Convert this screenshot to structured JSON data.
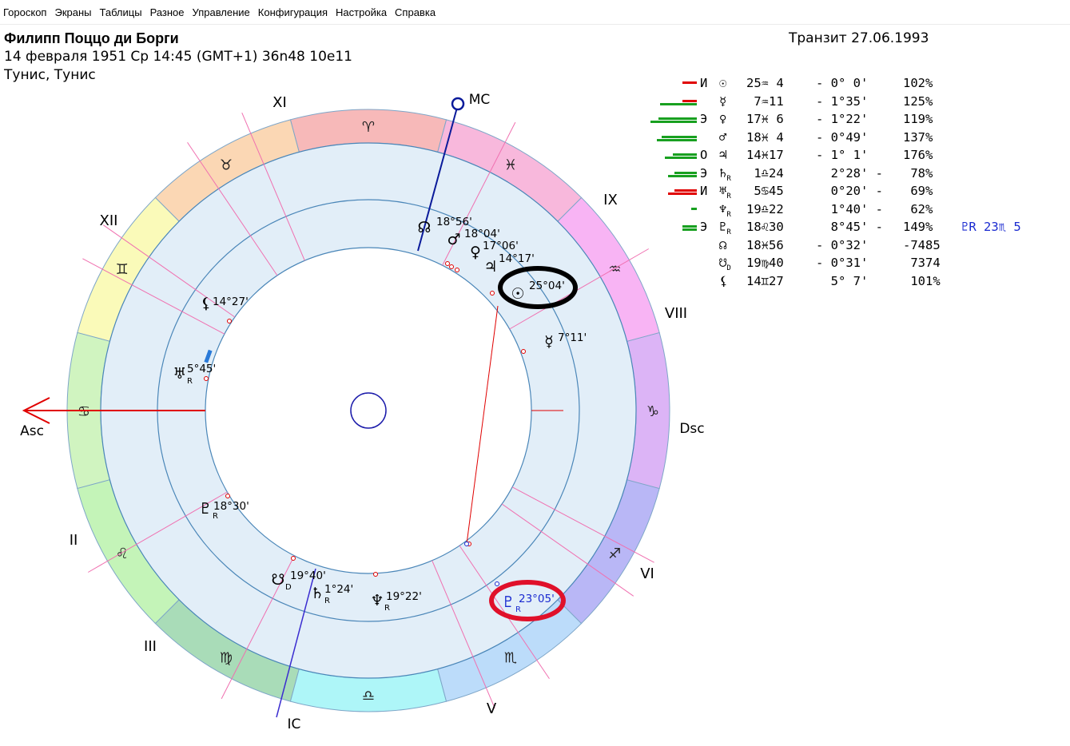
{
  "menu": [
    "Гороскоп",
    "Экраны",
    "Таблицы",
    "Разное",
    "Управление",
    "Конфигурация",
    "Настройка",
    "Справка"
  ],
  "header": {
    "name": "Филипп Поццо ди Борги",
    "date_line": "14 февраля 1951  Ср  14:45 (GMT+1) 36n48  10e11",
    "place": "Тунис, Тунис",
    "transit": "Транзит 27.06.1993"
  },
  "houses": {
    "labels": [
      "XI",
      "IX",
      "XII",
      "VIII",
      "II",
      "VI",
      "III",
      "V"
    ],
    "angles": {
      "mc": "MC",
      "asc": "Asc",
      "dsc": "Dsc",
      "ic": "IC"
    }
  },
  "zodiac_glyphs": [
    "♈",
    "♉",
    "♊",
    "♋",
    "♌",
    "♍",
    "♎",
    "♏",
    "♐",
    "♑",
    "♒",
    "♓"
  ],
  "inner_planets": [
    {
      "glyph": "☊",
      "deg": "18°56'"
    },
    {
      "glyph": "♂",
      "deg": "18°04'"
    },
    {
      "glyph": "♀",
      "deg": "17°06'"
    },
    {
      "glyph": "♃",
      "deg": "14°17'"
    },
    {
      "glyph": "☉",
      "deg": "25°04'"
    },
    {
      "glyph": "☿",
      "deg": "7°11'"
    },
    {
      "glyph": "⚸",
      "deg": "14°27'"
    },
    {
      "glyph": "♅",
      "sub": "R",
      "deg": "5°45'"
    },
    {
      "glyph": "♇",
      "sub": "R",
      "deg": "18°30'"
    },
    {
      "glyph": "☋",
      "sub": "D",
      "deg": "19°40'"
    },
    {
      "glyph": "♄",
      "sub": "R",
      "deg": "1°24'"
    },
    {
      "glyph": "♆",
      "sub": "R",
      "deg": "19°22'"
    },
    {
      "glyph": "♇",
      "sub": "R",
      "deg": "23°05'"
    }
  ],
  "aspect_table": [
    {
      "flag": "И",
      "glyph": "☉",
      "pos": "25♒ 4",
      "orb": "- 0° 0'",
      "pct": "102%",
      "bars": [
        {
          "c": "#e00000",
          "w": 18
        }
      ]
    },
    {
      "flag": "",
      "glyph": "☿",
      "pos": " 7♒11",
      "orb": "- 1°35'",
      "pct": "125%",
      "bars": [
        {
          "c": "#e00000",
          "w": 18
        },
        {
          "c": "#18a020",
          "w": 46
        }
      ]
    },
    {
      "flag": "Э",
      "glyph": "♀",
      "pos": "17♓ 6",
      "orb": "- 1°22'",
      "pct": "119%",
      "bars": [
        {
          "c": "#18a020",
          "w": 48
        },
        {
          "c": "#18a020",
          "w": 58
        }
      ]
    },
    {
      "flag": "",
      "glyph": "♂",
      "pos": "18♓ 4",
      "orb": "- 0°49'",
      "pct": "137%",
      "bars": [
        {
          "c": "#18a020",
          "w": 44
        },
        {
          "c": "#18a020",
          "w": 50
        }
      ]
    },
    {
      "flag": "О",
      "glyph": "♃",
      "pos": "14♓17",
      "orb": "- 1° 1'",
      "pct": "176%",
      "bars": [
        {
          "c": "#18a020",
          "w": 30
        },
        {
          "c": "#18a020",
          "w": 40
        }
      ]
    },
    {
      "flag": "Э",
      "glyph": "♄",
      "sub": "R",
      "pos": " 1♎24",
      "orb": "  2°28' -",
      "pct": " 78%",
      "bars": [
        {
          "c": "#18a020",
          "w": 28
        },
        {
          "c": "#18a020",
          "w": 36
        }
      ]
    },
    {
      "flag": "И",
      "glyph": "♅",
      "sub": "R",
      "pos": " 5♋45",
      "orb": "  0°20' -",
      "pct": " 69%",
      "bars": [
        {
          "c": "#e00000",
          "w": 28
        },
        {
          "c": "#e00000",
          "w": 36
        }
      ]
    },
    {
      "flag": "",
      "glyph": "♆",
      "sub": "R",
      "pos": "19♎22",
      "orb": "  1°40' -",
      "pct": " 62%",
      "bars": [
        {
          "c": "#18a020",
          "w": 7
        }
      ]
    },
    {
      "flag": "Э",
      "glyph": "♇",
      "sub": "R",
      "pos": "18♌30",
      "orb": "  8°45' -",
      "pct": "149%",
      "bars": [
        {
          "c": "#18a020",
          "w": 18
        },
        {
          "c": "#18a020",
          "w": 18
        }
      ],
      "extra": "♇R 23♏ 5"
    },
    {
      "flag": "",
      "glyph": "☊",
      "pos": "18♓56",
      "orb": "- 0°32'",
      "pct": "-7485",
      "bars": []
    },
    {
      "flag": "",
      "glyph": "☋",
      "sub": "D",
      "pos": "19♍40",
      "orb": "- 0°31'",
      "pct": " 7374",
      "bars": []
    },
    {
      "flag": "",
      "glyph": "⚸",
      "pos": "14♊27",
      "orb": "  5° 7'",
      "pct": " 101%",
      "bars": []
    }
  ],
  "colors": {
    "mc_axis": "#0a1a9a",
    "asc_axis": "#e00000",
    "highlight_black": "#000000",
    "highlight_red": "#e0102a",
    "transit_blue": "#1a2ad0"
  }
}
